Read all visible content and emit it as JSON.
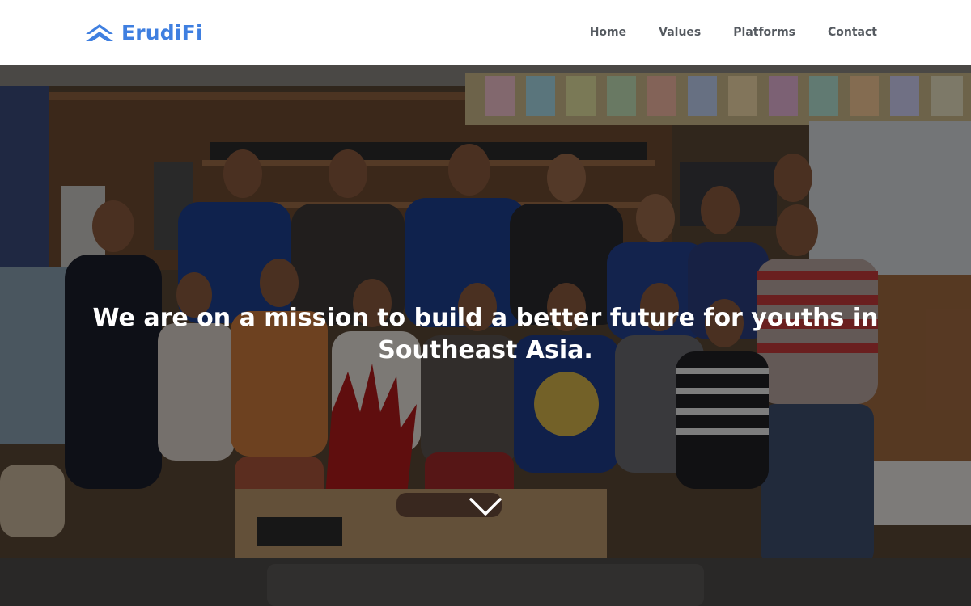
{
  "brand": {
    "name": "ErudiFi",
    "logo_icon": "mountain-chevron-logo",
    "color": "#3f7fe0"
  },
  "nav": {
    "items": [
      {
        "label": "Home"
      },
      {
        "label": "Values"
      },
      {
        "label": "Platforms"
      },
      {
        "label": "Contact"
      }
    ]
  },
  "hero": {
    "headline": "We are on a mission to build a better future for youths in Southeast Asia.",
    "background": "team-group-photo",
    "scroll_icon": "chevron-down-icon"
  }
}
